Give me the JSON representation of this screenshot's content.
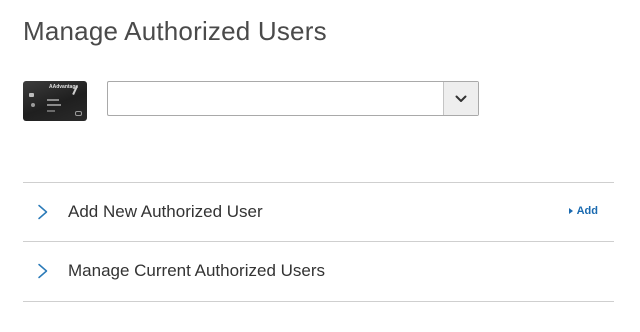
{
  "page": {
    "title": "Manage Authorized Users"
  },
  "card_selector": {
    "card_image_icon": "credit-card-icon",
    "card_brand": "AAdvantage",
    "selected_value": "",
    "dropdown_icon": "chevron-down-icon"
  },
  "sections": [
    {
      "label": "Add New Authorized User",
      "icon": "chevron-right-icon",
      "action_label": "Add",
      "action_icon": "triangle-right-icon"
    },
    {
      "label": "Manage Current Authorized Users",
      "icon": "chevron-right-icon"
    }
  ],
  "colors": {
    "title": "#4a4a4a",
    "link": "#1a6ab0",
    "chevron": "#2a7ab8",
    "divider": "#cfcfcf",
    "select_border": "#a9a9a9"
  }
}
